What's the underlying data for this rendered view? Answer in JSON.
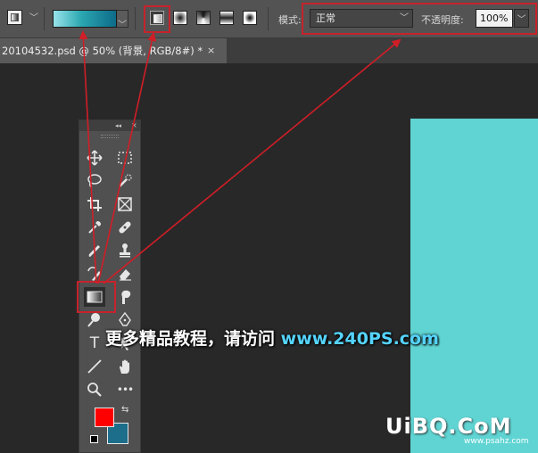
{
  "options_bar": {
    "mode_label": "模式:",
    "mode_value": "正常",
    "opacity_label": "不透明度:",
    "opacity_value": "100%",
    "gradient_colors": [
      "#2aa6b0",
      "#98e4ea",
      "#0d6c8a"
    ]
  },
  "document": {
    "tab_title": "20104532.psd @ 50% (背景, RGB/8#) *",
    "close_glyph": "×"
  },
  "colors": {
    "foreground": "#fe0000",
    "background": "#1d6e8a",
    "canvas_fill": "#5fd4d3",
    "highlight": "#c6232b"
  },
  "toolbox": {
    "collapse_glyph": "◂◂",
    "tools": [
      "move-icon",
      "marquee-icon",
      "lasso-icon",
      "quick-select-icon",
      "crop-icon",
      "frame-icon",
      "eyedropper-icon",
      "healing-icon",
      "brush-icon",
      "stamp-icon",
      "history-brush-icon",
      "eraser-icon",
      "gradient-icon",
      "smudge-icon",
      "dodge-icon",
      "pen-icon",
      "type-icon",
      "path-select-icon",
      "line-icon",
      "hand-icon",
      "zoom-icon",
      "more-icon"
    ],
    "type_tool_glyph": "T",
    "more_glyph": "•••"
  },
  "watermark": {
    "text": "更多精品教程，请访问",
    "url": "www.240PS.com"
  },
  "logo": {
    "text": "UiBQ.CoM",
    "sub": "www.psahz.com"
  }
}
